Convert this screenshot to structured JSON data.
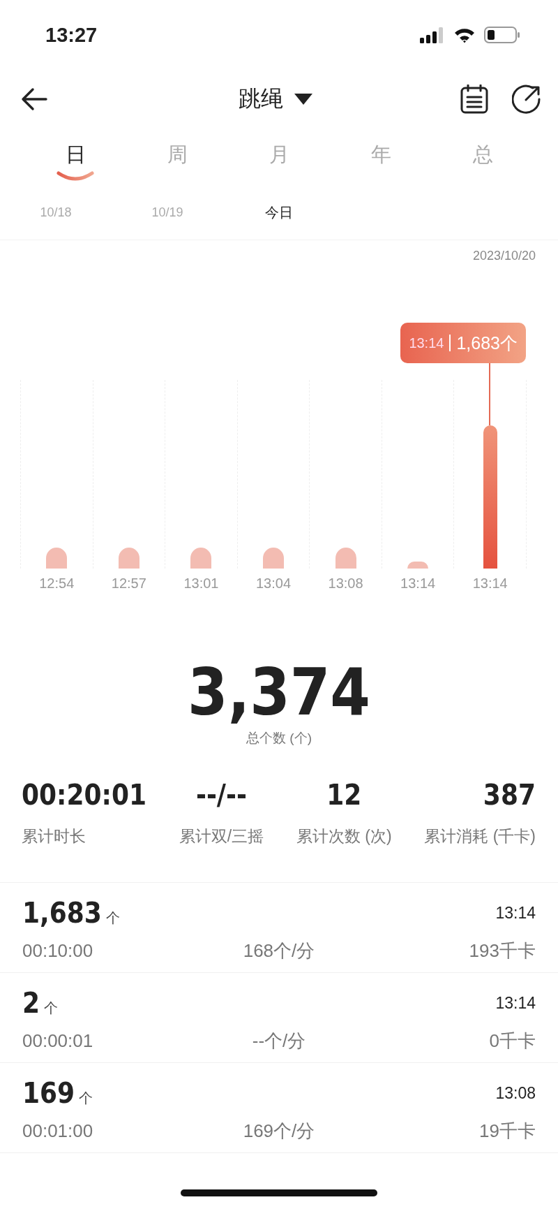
{
  "status_bar": {
    "time": "13:27"
  },
  "header": {
    "title": "跳绳"
  },
  "tabs": [
    {
      "label": "日",
      "selected": true
    },
    {
      "label": "周",
      "selected": false
    },
    {
      "label": "月",
      "selected": false
    },
    {
      "label": "年",
      "selected": false
    },
    {
      "label": "总",
      "selected": false
    }
  ],
  "days": [
    {
      "label": "10/18",
      "selected": false
    },
    {
      "label": "10/19",
      "selected": false
    },
    {
      "label": "今日",
      "selected": true
    }
  ],
  "chart": {
    "date": "2023/10/20",
    "tooltip": {
      "time": "13:14",
      "value": "1,683个"
    },
    "bars": [
      {
        "label": "12:54",
        "selected": false
      },
      {
        "label": "12:57",
        "selected": false
      },
      {
        "label": "13:01",
        "selected": false
      },
      {
        "label": "13:04",
        "selected": false
      },
      {
        "label": "13:08",
        "selected": false
      },
      {
        "label": "13:14",
        "selected": false
      },
      {
        "label": "13:14",
        "selected": true
      }
    ]
  },
  "total": {
    "value": "3,374",
    "label": "总个数 (个)"
  },
  "stats": [
    {
      "value": "00:20:01",
      "label": "累计时长"
    },
    {
      "value": "--/--",
      "label": "累计双/三摇"
    },
    {
      "value": "12",
      "label": "累计次数 (次)"
    },
    {
      "value": "387",
      "label": "累计消耗 (千卡)"
    }
  ],
  "sessions": [
    {
      "count": "1,683",
      "unit": "个",
      "time": "13:14",
      "duration": "00:10:00",
      "rate": "168个/分",
      "calories": "193千卡"
    },
    {
      "count": "2",
      "unit": "个",
      "time": "13:14",
      "duration": "00:00:01",
      "rate": "--个/分",
      "calories": "0千卡"
    },
    {
      "count": "169",
      "unit": "个",
      "time": "13:08",
      "duration": "00:01:00",
      "rate": "169个/分",
      "calories": "19千卡"
    }
  ]
}
